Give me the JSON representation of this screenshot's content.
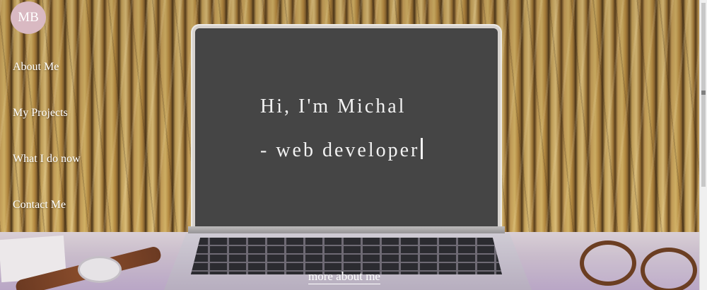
{
  "logo": {
    "text": "MB"
  },
  "nav": {
    "items": [
      {
        "label": "About Me"
      },
      {
        "label": "My Projects"
      },
      {
        "label": "What I do now"
      },
      {
        "label": "Contact Me"
      }
    ]
  },
  "hero": {
    "line1": "Hi, I'm Michal",
    "line2": "- web developer"
  },
  "cta": {
    "label": "more about me"
  },
  "colors": {
    "screen": "#454545",
    "logo_bg": "#d9b9c2",
    "text": "#ffffff"
  }
}
